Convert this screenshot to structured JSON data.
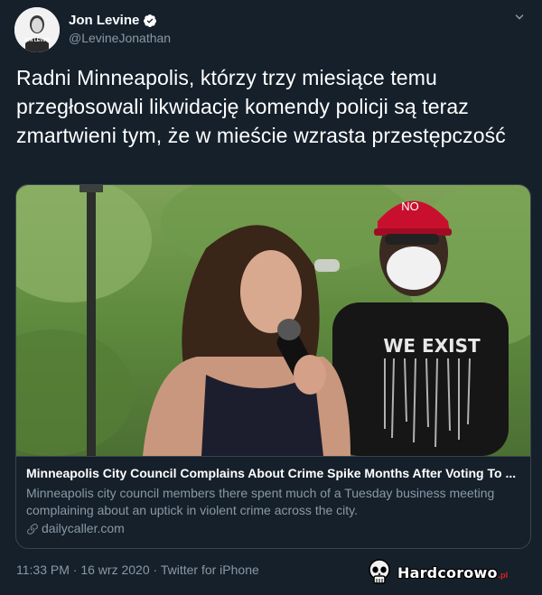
{
  "tweet": {
    "author_name": "Jon Levine",
    "author_handle": "@LevineJonathan",
    "avatar_caption": "JON LEVINE",
    "text": "Radni Minneapolis, którzy trzy miesiące temu przegłosowali likwidację komendy policji są teraz zmartwieni tym, że w mieście wzrasta przestępczość"
  },
  "card": {
    "image_sign_text": "NO",
    "shirt_text": "WE EXIST",
    "title": "Minneapolis City Council Complains About Crime Spike Months After Voting To ...",
    "description": "Minneapolis city council members there spent much of a Tuesday business meeting complaining about an uptick in violent crime across the city.",
    "domain": "dailycaller.com"
  },
  "meta": {
    "time": "11:33 PM",
    "separator": "·",
    "date": "16 wrz 2020",
    "source": "Twitter for iPhone"
  },
  "watermark": {
    "brand": "Hardcorowo",
    "suffix": ".pl"
  },
  "colors": {
    "background": "#15202b",
    "border": "#38444d",
    "muted_text": "#8899a6",
    "verified_blue": "#ffffff",
    "cap_red": "#c8102e"
  },
  "icons": {
    "verified": "verified-badge-icon",
    "caret": "chevron-down-icon",
    "link": "link-icon",
    "watermark": "skull-icon"
  }
}
